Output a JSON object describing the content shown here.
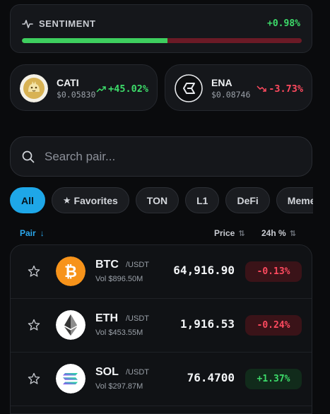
{
  "sentiment": {
    "label": "SENTIMENT",
    "value": "+0.98%",
    "bullish_fraction": 0.52
  },
  "tokens": [
    {
      "name": "CATI",
      "price": "$0.05830",
      "change": "+45.02%",
      "direction": "up",
      "icon": "cati-cat-icon"
    },
    {
      "name": "ENA",
      "price": "$0.08746",
      "change": "-3.73%",
      "direction": "down",
      "icon": "ena-logo-icon"
    }
  ],
  "search": {
    "placeholder": "Search pair..."
  },
  "filters": [
    {
      "label": "All",
      "active": true
    },
    {
      "label": "Favorites",
      "icon": "star-icon"
    },
    {
      "label": "TON"
    },
    {
      "label": "L1"
    },
    {
      "label": "DeFi"
    },
    {
      "label": "Meme"
    }
  ],
  "table": {
    "headers": {
      "pair": "Pair",
      "price": "Price",
      "change": "24h %"
    },
    "rows": [
      {
        "symbol": "BTC",
        "quote": "/USDT",
        "volume": "Vol $896.50M",
        "price": "64,916.90",
        "change": "-0.13%",
        "direction": "down"
      },
      {
        "symbol": "ETH",
        "quote": "/USDT",
        "volume": "Vol $453.55M",
        "price": "1,916.53",
        "change": "-0.24%",
        "direction": "down"
      },
      {
        "symbol": "SOL",
        "quote": "/USDT",
        "volume": "Vol $297.87M",
        "price": "76.4700",
        "change": "+1.37%",
        "direction": "up"
      }
    ]
  },
  "colors": {
    "accent": "#1ea7e8",
    "positive": "#3ddc6a",
    "negative": "#ff4a5f",
    "btc": "#f7931a"
  }
}
